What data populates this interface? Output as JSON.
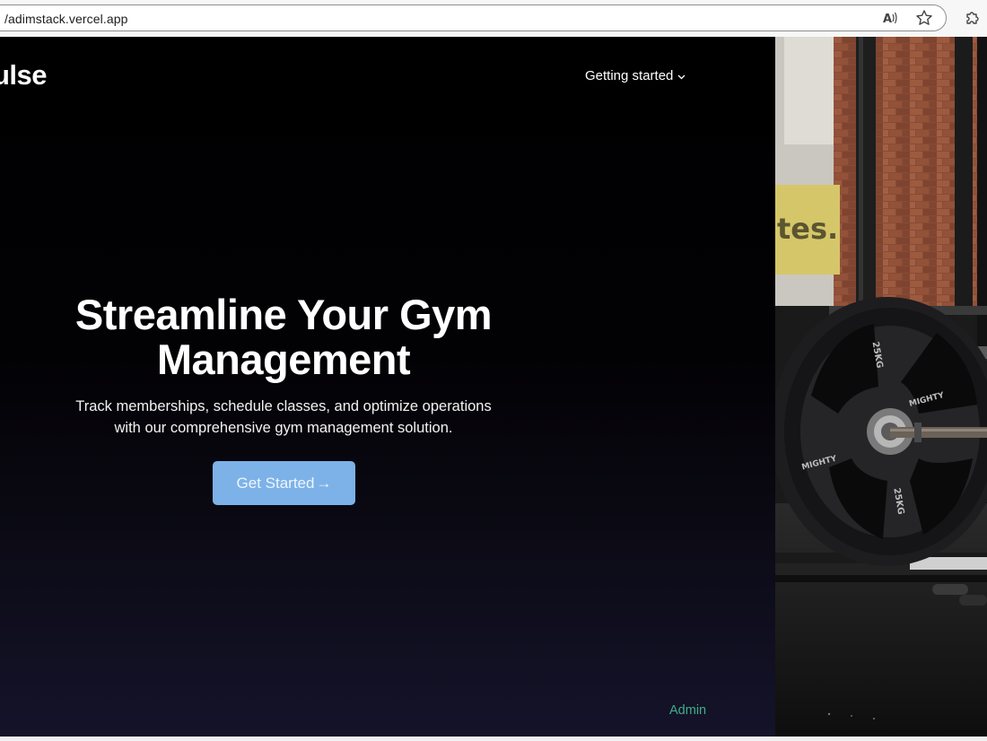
{
  "browser": {
    "url": "/adimstack.vercel.app",
    "icons": [
      "read-aloud-icon",
      "favorite-star-icon",
      "extensions-puzzle-icon"
    ]
  },
  "nav": {
    "logo": "ulse",
    "getting_started": "Getting started"
  },
  "hero": {
    "headline_line1": "Streamline Your Gym",
    "headline_line2": "Management",
    "subtext_line1": "Track memberships, schedule classes, and optimize operations",
    "subtext_line2": "with our comprehensive gym management solution.",
    "cta_label": "Get Started",
    "cta_arrow": "→"
  },
  "footer": {
    "admin_link": "Admin"
  },
  "photo": {
    "sign_text": "tes.",
    "plate_text_1": "25KG",
    "plate_text_2": "MIGHTY",
    "plate_text_3": "25KG",
    "plate_text_4": "MIGHTY"
  },
  "colors": {
    "cta_bg": "#7cb2e8",
    "admin_link": "#3fae8a",
    "hero_bg_top": "#000000",
    "hero_bg_bottom": "#15132a"
  }
}
